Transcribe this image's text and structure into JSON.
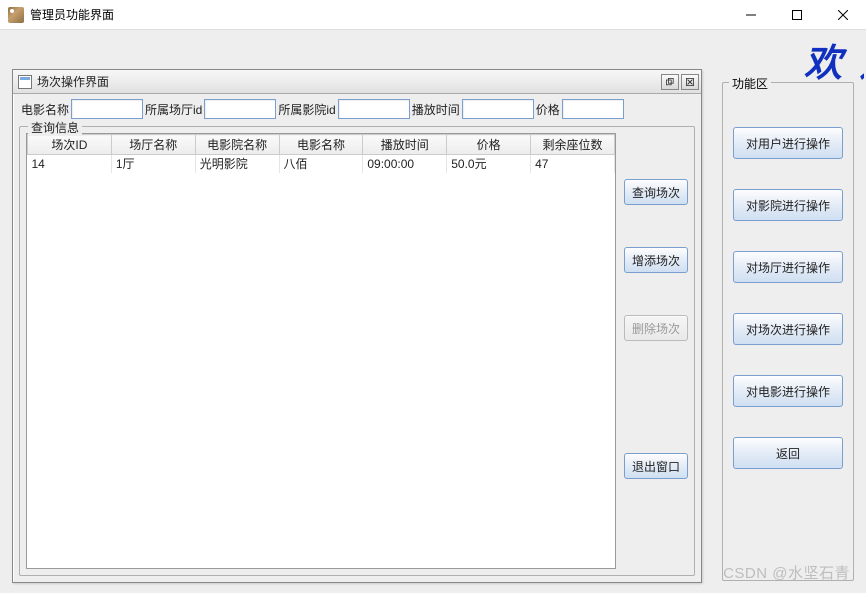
{
  "window": {
    "title": "管理员功能界面"
  },
  "banner": "欢 迎",
  "internal_frame": {
    "title": "场次操作界面"
  },
  "inputs": {
    "movie_name_label": "电影名称",
    "movie_name_value": "",
    "hall_id_label": "所属场厅id",
    "hall_id_value": "",
    "cinema_id_label": "所属影院id",
    "cinema_id_value": "",
    "play_time_label": "播放时间",
    "play_time_value": "",
    "price_label": "价格",
    "price_value": ""
  },
  "fieldset_title": "查询信息",
  "table": {
    "headers": [
      "场次ID",
      "场厅名称",
      "电影院名称",
      "电影名称",
      "播放时间",
      "价格",
      "剩余座位数"
    ],
    "rows": [
      [
        "14",
        "1厅",
        "光明影院",
        "八佰",
        "09:00:00",
        "50.0元",
        "47"
      ]
    ]
  },
  "ops_buttons": {
    "query": "查询场次",
    "add": "增添场次",
    "delete": "删除场次",
    "exit": "退出窗口"
  },
  "func_region": {
    "title": "功能区",
    "btn_user": "对用户进行操作",
    "btn_cinema": "对影院进行操作",
    "btn_hall": "对场厅进行操作",
    "btn_session": "对场次进行操作",
    "btn_movie": "对电影进行操作",
    "btn_back": "返回"
  },
  "watermark": "CSDN @水坚石青"
}
